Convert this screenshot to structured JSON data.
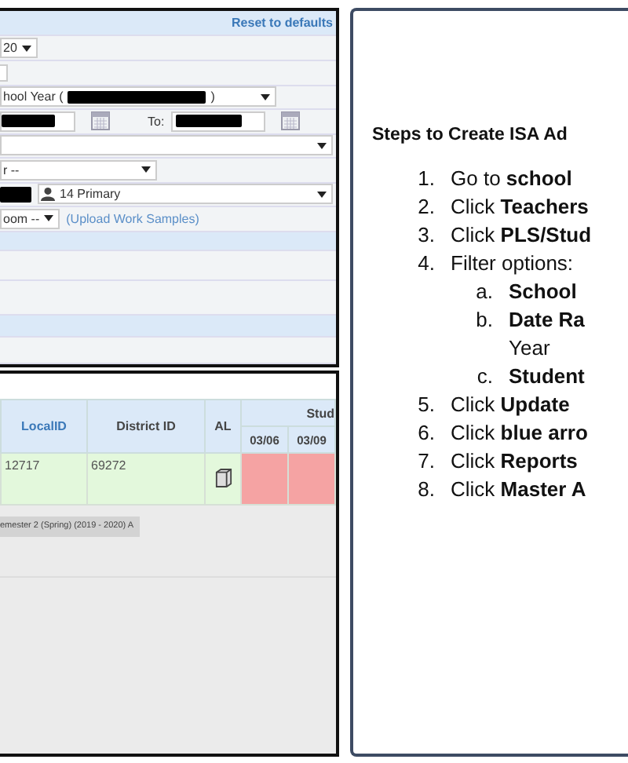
{
  "filter_panel": {
    "reset_link": "Reset to defaults",
    "year_select": "20",
    "school_year_select": {
      "prefix": "hool Year (",
      "suffix": ")"
    },
    "date_range": {
      "to_label": "To:"
    },
    "teacher_select": "r --",
    "student_select": "14 Primary",
    "classroom_select": "oom --",
    "upload_link": "(Upload Work Samples)"
  },
  "table": {
    "columns": [
      "LocalID",
      "District ID",
      "AL"
    ],
    "group_header": "Stud",
    "subcolumns": [
      "03/06",
      "03/09"
    ],
    "rows": [
      {
        "local_id": "12717",
        "district_id": "69272"
      }
    ]
  },
  "term_tag": "emester 2 (Spring) (2019 - 2020) A",
  "steps": {
    "title": "Steps to Create ISA Ad",
    "items": [
      {
        "marker": "1.",
        "text": "Go to **school**"
      },
      {
        "marker": "2.",
        "text": "Click **Teachers**"
      },
      {
        "marker": "3.",
        "text": "Click **PLS/Stud**"
      },
      {
        "marker": "4.",
        "text": "Filter options:",
        "children": [
          {
            "marker": "a.",
            "text": "**School**"
          },
          {
            "marker": "b.",
            "text": "**Date Ra**",
            "continuation": "Year"
          },
          {
            "marker": "c.",
            "text": "**Student**"
          }
        ]
      },
      {
        "marker": "5.",
        "text": "Click **Update**"
      },
      {
        "marker": "6.",
        "text": "Click **blue arro**"
      },
      {
        "marker": "7.",
        "text": "Click **Reports**"
      },
      {
        "marker": "8.",
        "text": "Click **Master A**"
      }
    ]
  }
}
